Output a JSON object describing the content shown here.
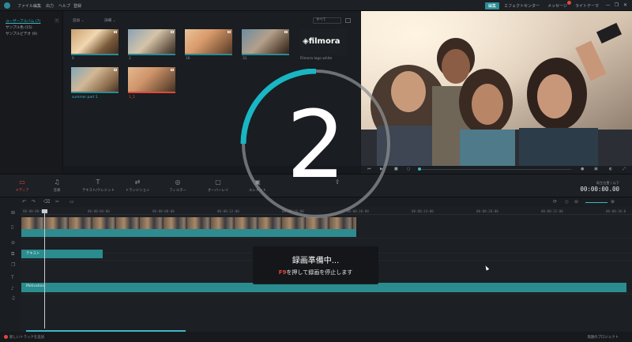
{
  "menu": [
    "ファイル",
    "編集",
    "出力",
    "ヘルプ",
    "登録"
  ],
  "top_tabs": [
    {
      "label": "編集",
      "active": true
    },
    {
      "label": "エフェクトセンター",
      "active": false
    },
    {
      "label": "メッセージ",
      "active": false
    },
    {
      "label": "ライトテーマ",
      "active": false
    }
  ],
  "window_controls": [
    "—",
    "❐",
    "✕"
  ],
  "library": {
    "folders": [
      "ユーザーアルバム (7)",
      "サンプル色 (15)",
      "サンプルビデオ (9)"
    ],
    "sort_dropdown": "追加",
    "view_dropdown": "詳細",
    "search_placeholder": "すべて",
    "media": [
      {
        "label": "6"
      },
      {
        "label": "2"
      },
      {
        "label": "16"
      },
      {
        "label": "31"
      },
      {
        "label": "Filmora logo white",
        "logo_text": "filmora"
      },
      {
        "label": "summer part 1"
      },
      {
        "label": "1_5"
      }
    ]
  },
  "toolbar": {
    "tools": [
      {
        "label": "メディア",
        "icon": "folder-icon",
        "glyph": "▭"
      },
      {
        "label": "音楽",
        "icon": "music-icon",
        "glyph": "♫"
      },
      {
        "label": "テキスト/クレジット",
        "icon": "text-icon",
        "glyph": "T"
      },
      {
        "label": "トランジション",
        "icon": "transition-icon",
        "glyph": "⇄"
      },
      {
        "label": "フィルター",
        "icon": "filter-icon",
        "glyph": "◎"
      },
      {
        "label": "オーバーレイ",
        "icon": "overlay-icon",
        "glyph": "▢"
      },
      {
        "label": "エレメント",
        "icon": "element-icon",
        "glyph": "▣"
      },
      {
        "label": "",
        "icon": "export-icon",
        "glyph": "⇪"
      }
    ],
    "time_label": "再生位置 / 以下",
    "time_value": "00:00:00.00"
  },
  "timeline": {
    "ticks": [
      "00:00:00:00",
      "00:00:04:00",
      "00:00:08:00",
      "00:00:12:00",
      "00:00:16:00",
      "00:00:20:00",
      "00:00:24:00",
      "00:00:28:00",
      "00:00:32:00",
      "00:00:36:0"
    ],
    "text_clip_label": "テキスト",
    "audio_clip_label": "Motivation"
  },
  "status": {
    "add_track": "新しいトラックを追加",
    "project_name": "無題のプロジェクト"
  },
  "overlay": {
    "countdown": "2",
    "countdown_progress": 0.25,
    "title": "録画準備中...",
    "hint_key": "F9",
    "hint_text": "を押して録画を停止します"
  },
  "colors": {
    "accent": "#2b8b95",
    "ring_active": "#19b6c4",
    "alert": "#e0493c"
  }
}
